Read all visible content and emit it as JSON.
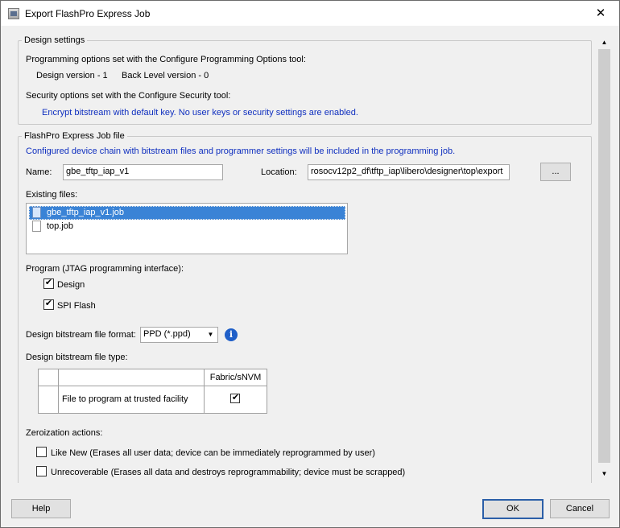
{
  "window": {
    "title": "Export FlashPro Express Job",
    "close_glyph": "✕"
  },
  "design_settings": {
    "legend": "Design settings",
    "prog_options_text": "Programming options set with the Configure Programming Options tool:",
    "design_version": "Design version - 1",
    "back_level_version": "Back Level version - 0",
    "security_text": "Security options set with the Configure Security tool:",
    "security_detail": "Encrypt bitstream with default key. No user keys or security settings are enabled."
  },
  "job_file": {
    "legend": "FlashPro Express Job file",
    "description": "Configured device chain with bitstream files and programmer settings will be included in the programming job.",
    "name_label": "Name:",
    "name_value": "gbe_tftp_iap_v1",
    "location_label": "Location:",
    "location_value": "rosocv12p2_df\\tftp_iap\\libero\\designer\\top\\export",
    "browse_label": "...",
    "existing_files_label": "Existing files:",
    "files": [
      {
        "name": "gbe_tftp_iap_v1.job",
        "selected": true
      },
      {
        "name": "top.job",
        "selected": false
      }
    ],
    "program_label": "Program (JTAG programming interface):",
    "program_design_label": "Design",
    "program_design_checked": true,
    "program_spi_label": "SPI Flash",
    "program_spi_checked": true,
    "format_label": "Design bitstream file format:",
    "format_value": "PPD (*.ppd)",
    "filetype_label": "Design bitstream file type:",
    "filetype_table": {
      "column_header": "Fabric/sNVM",
      "row_label": "File to program at trusted facility",
      "row_checked": true
    },
    "zeroization_label": "Zeroization actions:",
    "zero_like_new_label": "Like New (Erases all user data; device can be immediately reprogrammed by user)",
    "zero_like_new_checked": false,
    "zero_unrecoverable_label": "Unrecoverable (Erases all data and destroys reprogrammability; device must be scrapped)",
    "zero_unrecoverable_checked": false
  },
  "buttons": {
    "help": "Help",
    "ok": "OK",
    "cancel": "Cancel"
  },
  "icons": {
    "check_glyph": "✔",
    "info_glyph": "i",
    "dropdown_glyph": "▼",
    "scroll_up_glyph": "▲",
    "scroll_down_glyph": "▼"
  }
}
